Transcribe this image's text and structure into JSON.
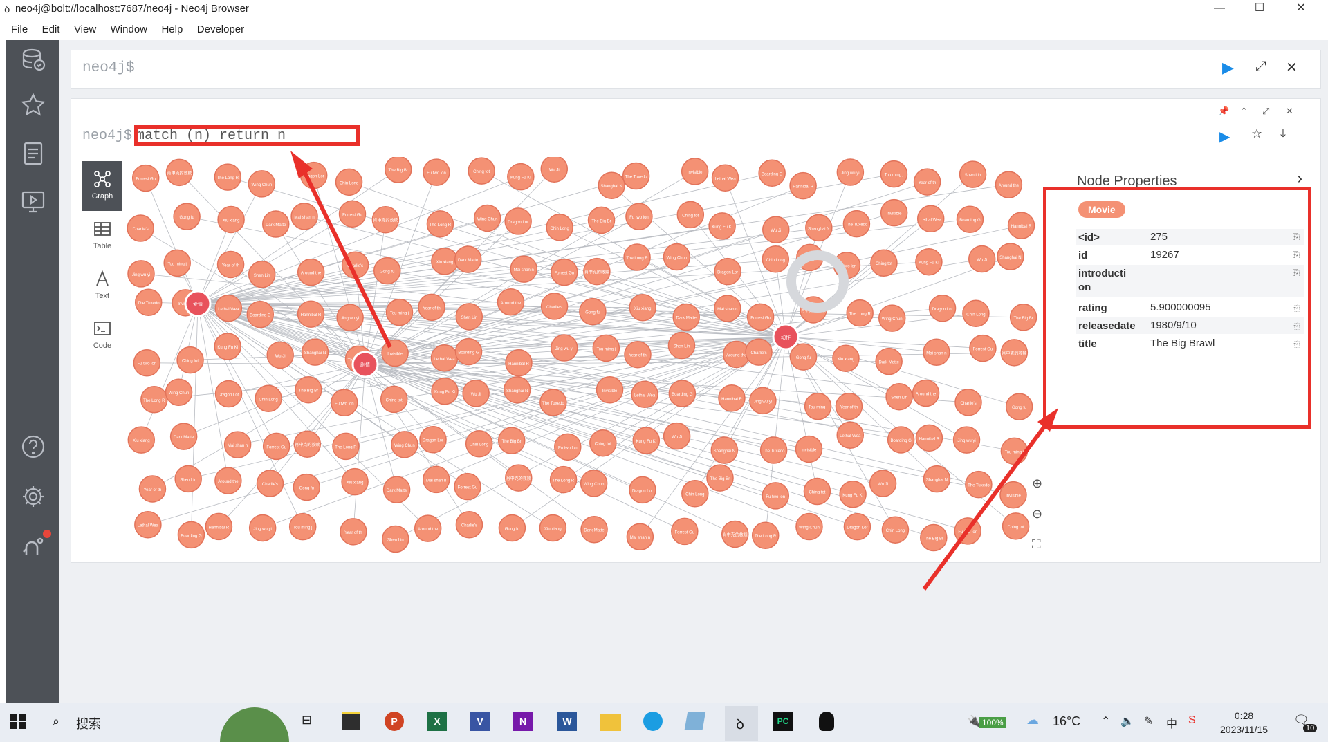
{
  "window": {
    "title": "neo4j@bolt://localhost:7687/neo4j - Neo4j Browser",
    "minimize": "—",
    "maximize": "☐",
    "close": "✕"
  },
  "menu": [
    "File",
    "Edit",
    "View",
    "Window",
    "Help",
    "Developer"
  ],
  "editor": {
    "prompt": "neo4j$"
  },
  "query": {
    "prompt": "neo4j$",
    "text": "match (n) return n"
  },
  "views": [
    {
      "label": "Graph",
      "icon": "graph-icon"
    },
    {
      "label": "Table",
      "icon": "table-icon"
    },
    {
      "label": "Text",
      "icon": "text-icon"
    },
    {
      "label": "Code",
      "icon": "code-icon"
    }
  ],
  "graph": {
    "node_color": "#f49174",
    "node_border": "#e2735a",
    "hub_color": "#e8525c",
    "hub_labels": [
      "爱情",
      "剧情",
      "动作"
    ],
    "node_labels": [
      "Forrest Gump",
      "肖申克的救赎",
      "The Long Run",
      "Wing Chun",
      "Dragon Lord",
      "Chin Long Chuen Su",
      "The Big Brawl",
      "Fu two long she yin",
      "Ching tot",
      "Kung Fu Killer",
      "Wu Ji",
      "Shanghai Noon",
      "The Tuxedo",
      "Invisible Waves",
      "Lethal Weapon",
      "Boarding Gate",
      "Hannibal Rising",
      "Jing wu ying xiong",
      "Tou ming jì D",
      "Year of the Dog",
      "Shen Lin",
      "Around the World in",
      "Charlie's A",
      "Gong fu",
      "Xiu xiang",
      "Dark Matter",
      "Mai shan nian shi"
    ]
  },
  "properties": {
    "title": "Node Properties",
    "label_pill": "Movie",
    "rows": [
      {
        "key": "<id>",
        "value": "275"
      },
      {
        "key": "id",
        "value": "19267"
      },
      {
        "key": "introduction",
        "value": ""
      },
      {
        "key": "rating",
        "value": "5.900000095"
      },
      {
        "key": "releasedate",
        "value": "1980/9/10"
      },
      {
        "key": "title",
        "value": "The Big Brawl"
      }
    ]
  },
  "annotation_color": "#e9302a",
  "taskbar": {
    "search_label": "搜索",
    "battery": "100%",
    "weather": "16°C",
    "time": "0:28",
    "date": "2023/11/15",
    "notifications": "10"
  }
}
